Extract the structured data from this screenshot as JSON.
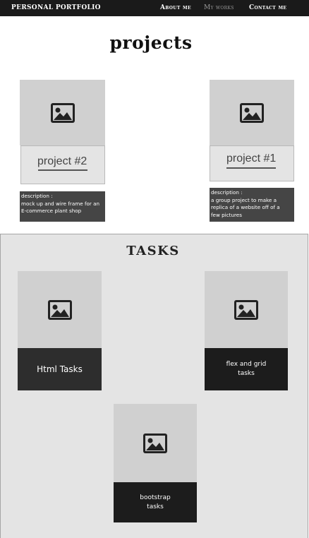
{
  "nav": {
    "brand": "Personal Portfolio",
    "items": [
      {
        "label": "About me",
        "active": false
      },
      {
        "label": "My works",
        "active": true
      },
      {
        "label": "Contact me",
        "active": false
      }
    ]
  },
  "projects": {
    "title": "projects",
    "cards": [
      {
        "label": "project #2",
        "description_lines": [
          "description :",
          "mock up and wire frame for an",
          "E-commerce plant shop"
        ],
        "icon": "image-icon"
      },
      {
        "label": "project #1",
        "description_lines": [
          "description :",
          "a group project to make  a",
          "replica  of a website off of a",
          "few pictures"
        ],
        "icon": "image-icon"
      }
    ]
  },
  "tasks": {
    "title": "TASKS",
    "cards": [
      {
        "label": "Html Tasks",
        "lines": [
          "Html Tasks"
        ],
        "icon": "image-icon"
      },
      {
        "label": "flex and grid tasks",
        "lines": [
          "flex and grid",
          "tasks"
        ],
        "icon": "image-icon"
      },
      {
        "label": "bootstrap tasks",
        "lines": [
          "bootstrap",
          "tasks"
        ],
        "icon": "image-icon"
      }
    ]
  },
  "colors": {
    "navbar": "#1a1a1a",
    "nav_active": "#9a9a9a",
    "image_placeholder": "#d0d0d0",
    "tasks_background": "#e4e4e4",
    "description_background": "#454545"
  }
}
